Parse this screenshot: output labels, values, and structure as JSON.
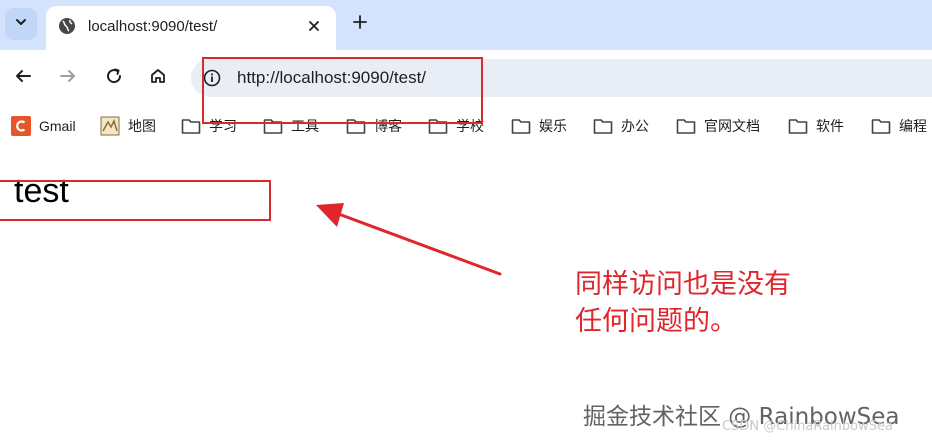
{
  "browser": {
    "tab": {
      "title": "localhost:9090/test/",
      "favicon": "globe-icon"
    },
    "toolbar": {
      "back_icon": "back-arrow-icon",
      "forward_icon": "forward-arrow-icon",
      "reload_icon": "reload-icon",
      "home_icon": "home-icon",
      "url": "http://localhost:9090/test/"
    },
    "bookmarks": [
      {
        "label": "Gmail",
        "icon": "gmail-icon"
      },
      {
        "label": "地图",
        "icon": "map-icon"
      },
      {
        "label": "学习",
        "icon": "folder-icon"
      },
      {
        "label": "工具",
        "icon": "folder-icon"
      },
      {
        "label": "博客",
        "icon": "folder-icon"
      },
      {
        "label": "学校",
        "icon": "folder-icon"
      },
      {
        "label": "娱乐",
        "icon": "folder-icon"
      },
      {
        "label": "办公",
        "icon": "folder-icon"
      },
      {
        "label": "官网文档",
        "icon": "folder-icon"
      },
      {
        "label": "软件",
        "icon": "folder-icon"
      },
      {
        "label": "编程",
        "icon": "folder-icon"
      }
    ]
  },
  "page": {
    "heading": "test"
  },
  "annotation": {
    "line1": "同样访问也是没有",
    "line2": "任何问题的。",
    "color": "#e0262b"
  },
  "watermark": {
    "main": "掘金技术社区 @ RainbowSea",
    "sub": "CSDN @ChinaRainbowSea"
  }
}
